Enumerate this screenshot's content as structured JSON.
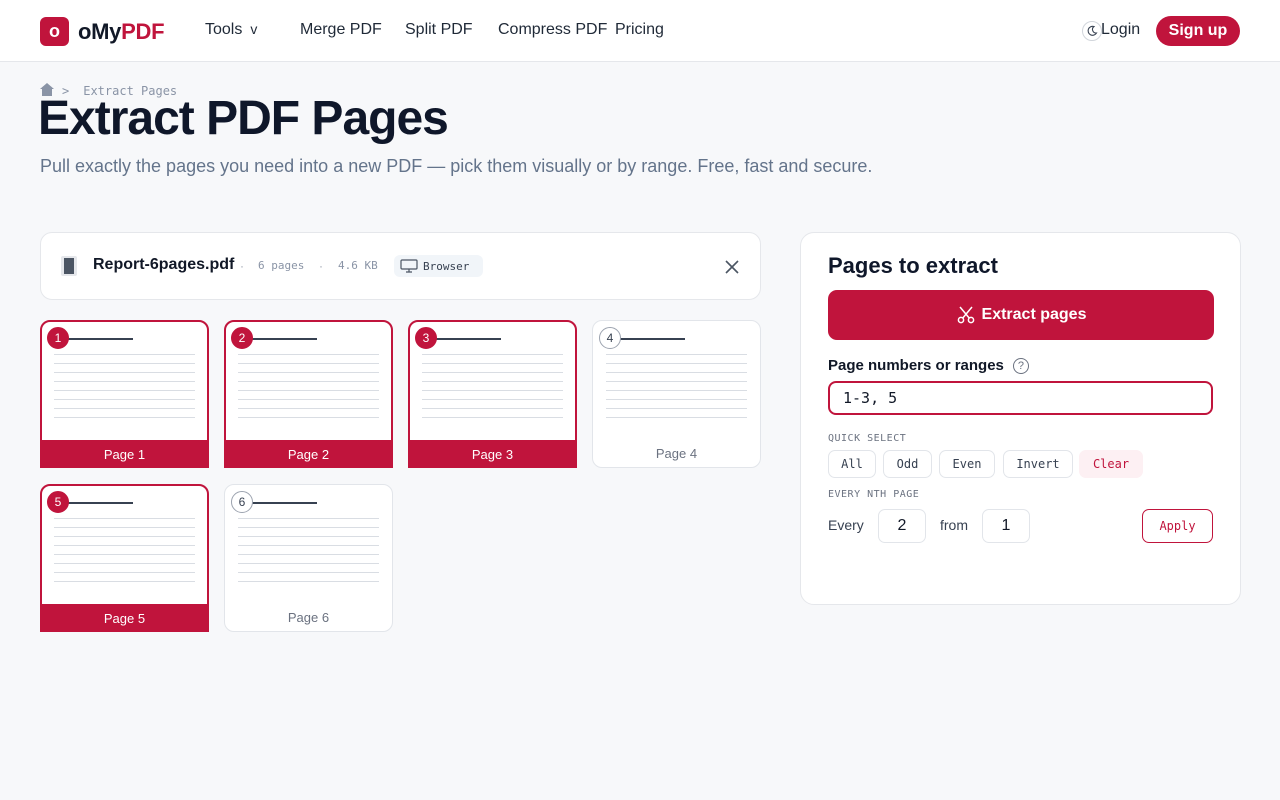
{
  "header": {
    "logo_mark": "o",
    "logo_prefix": "oMy",
    "logo_accent": "PDF",
    "nav": [
      {
        "label": "Tools",
        "chevron": "v"
      },
      {
        "label": "Merge PDF"
      },
      {
        "label": "Split PDF"
      },
      {
        "label": "Compress PDF"
      },
      {
        "label": "Pricing"
      }
    ],
    "login_label": "Login",
    "signup_label": "Sign up"
  },
  "breadcrumb": {
    "separator": ">",
    "current": "Extract Pages"
  },
  "hero": {
    "title": "Extract PDF Pages",
    "subtitle": "Pull exactly the pages you need into a new PDF — pick them visually or by range. Free, fast and secure."
  },
  "file": {
    "name": "Report-6pages.pdf",
    "pages": "6 pages",
    "size": "4.6 KB",
    "badge": "Browser",
    "dot": "·"
  },
  "pages": [
    {
      "number": "1",
      "label": "Page 1",
      "selected": true
    },
    {
      "number": "2",
      "label": "Page 2",
      "selected": true
    },
    {
      "number": "3",
      "label": "Page 3",
      "selected": true
    },
    {
      "number": "4",
      "label": "Page 4",
      "selected": false
    },
    {
      "number": "5",
      "label": "Page 5",
      "selected": true
    },
    {
      "number": "6",
      "label": "Page 6",
      "selected": false
    }
  ],
  "panel": {
    "title": "Pages to extract",
    "extract_label": "Extract pages",
    "range_label": "Page numbers or ranges",
    "help": "?",
    "range_value": "1-3, 5",
    "quick_select_label": "QUICK SELECT",
    "quick_select": [
      "All",
      "Odd",
      "Even",
      "Invert",
      "Clear"
    ],
    "nth_label": "EVERY NTH PAGE",
    "every_label": "Every",
    "every_value": "2",
    "from_label": "from",
    "from_value": "1",
    "apply_label": "Apply"
  },
  "colors": {
    "accent": "#c0143c",
    "text_dark": "#0f172a",
    "muted": "#64748b"
  },
  "icons": {
    "home": "home-icon",
    "moon": "moon-icon",
    "file": "file-icon",
    "monitor": "monitor-icon",
    "close": "close-icon",
    "scissors": "scissors-icon",
    "help": "help-icon"
  }
}
